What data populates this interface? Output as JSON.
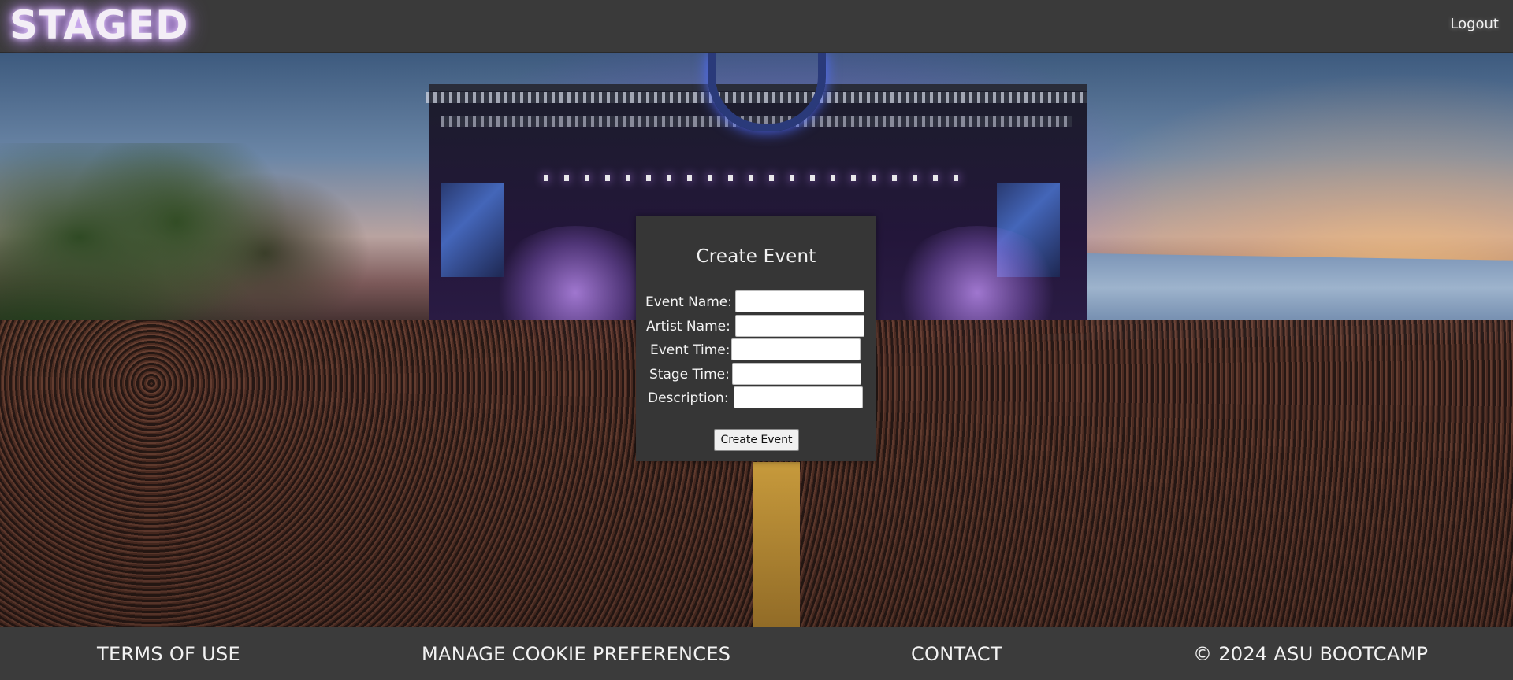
{
  "header": {
    "logo_text": "STAGED",
    "logout_label": "Logout"
  },
  "form": {
    "title": "Create Event",
    "fields": [
      {
        "label": "Event Name:",
        "value": "",
        "placeholder": ""
      },
      {
        "label": "Artist Name:",
        "value": "",
        "placeholder": ""
      },
      {
        "label": "Event Time:",
        "value": "",
        "placeholder": ""
      },
      {
        "label": "Stage Time:",
        "value": "",
        "placeholder": ""
      },
      {
        "label": "Description:",
        "value": "",
        "placeholder": ""
      }
    ],
    "submit_label": "Create Event"
  },
  "footer": {
    "terms_label": "TERMS OF USE",
    "cookies_label": "MANAGE COOKIE PREFERENCES",
    "contact_label": "CONTACT",
    "copyright": "© 2024 ASU BOOTCAMP"
  },
  "colors": {
    "bar_background": "#3a3a3a",
    "card_background": "#363636",
    "logo_glow": "#c9a0ff"
  },
  "hero": {
    "image_description_icon": "festival-stage-image"
  }
}
